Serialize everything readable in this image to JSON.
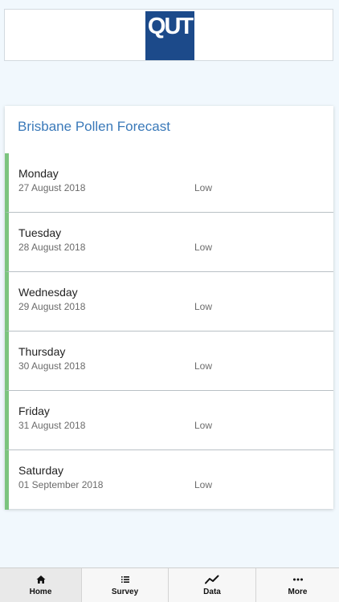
{
  "header": {
    "logo_text": "QUT"
  },
  "forecast": {
    "title": "Brisbane Pollen Forecast",
    "days": [
      {
        "day": "Monday",
        "date": "27 August 2018",
        "level": "Low"
      },
      {
        "day": "Tuesday",
        "date": "28 August 2018",
        "level": "Low"
      },
      {
        "day": "Wednesday",
        "date": "29 August 2018",
        "level": "Low"
      },
      {
        "day": "Thursday",
        "date": "30 August 2018",
        "level": "Low"
      },
      {
        "day": "Friday",
        "date": "31 August 2018",
        "level": "Low"
      },
      {
        "day": "Saturday",
        "date": "01 September 2018",
        "level": "Low"
      }
    ]
  },
  "tabs": [
    {
      "label": "Home",
      "icon": "home-icon"
    },
    {
      "label": "Survey",
      "icon": "list-icon"
    },
    {
      "label": "Data",
      "icon": "chart-line-icon"
    },
    {
      "label": "More",
      "icon": "more-dots-icon"
    }
  ],
  "colors": {
    "accent_blue": "#3a79b9",
    "logo_blue": "#1c4a8a",
    "level_low_green": "#7cc47f"
  }
}
